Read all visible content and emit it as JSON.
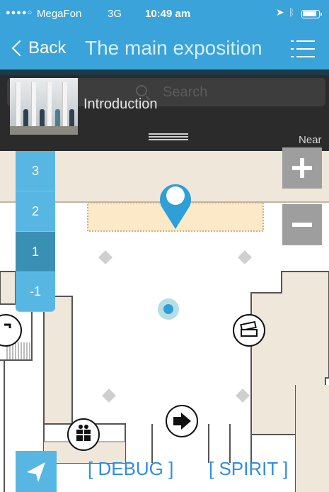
{
  "status_bar": {
    "signal_dots": "●●●●○",
    "carrier": "MegaFon",
    "network": "3G",
    "time": "10:49 am",
    "icons": [
      "location-arrow-icon",
      "bluetooth-icon",
      "battery-icon"
    ]
  },
  "nav": {
    "back_label": "Back",
    "title": "The main exposition",
    "menu_icon": "list-menu-icon"
  },
  "search": {
    "placeholder": "Search"
  },
  "exhibit": {
    "label": "Introduction",
    "near_label": "Near"
  },
  "floors": [
    {
      "label": "3",
      "active": false
    },
    {
      "label": "2",
      "active": false
    },
    {
      "label": "1",
      "active": true
    },
    {
      "label": "-1",
      "active": false
    }
  ],
  "zoom": {
    "in_icon": "plus-icon",
    "out_icon": "minus-icon"
  },
  "map_icons": [
    "map-pin-icon",
    "user-location-icon",
    "tickets-icon",
    "exit-icon",
    "gift-shop-icon",
    "staircase-icon"
  ],
  "bottom": {
    "locate_icon": "navigation-arrow-icon",
    "debug_label": "[ DEBUG ]",
    "spirit_label": "[ SPIRIT ]"
  },
  "colors": {
    "header": "#3aa3d9",
    "floor_button": "#57b7e2",
    "floor_button_active": "#3a8fb4",
    "link": "#2f8de4",
    "map_room": "#efe7da"
  }
}
